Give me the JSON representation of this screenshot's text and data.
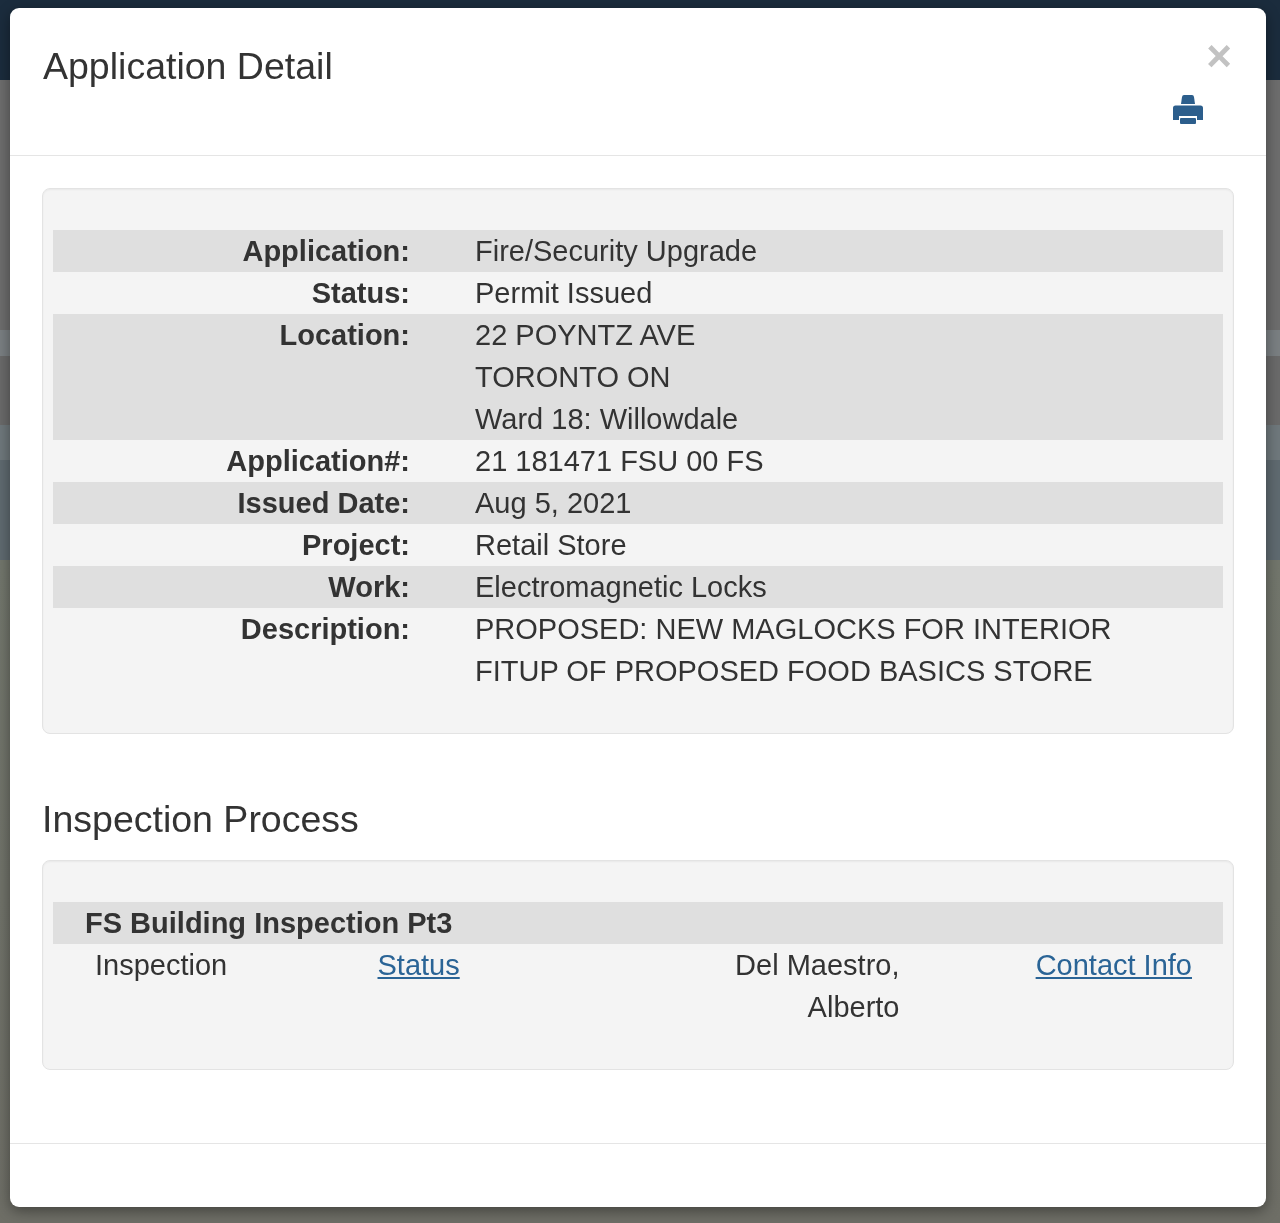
{
  "dialog": {
    "title": "Application Detail",
    "close": "×"
  },
  "details": {
    "rows": [
      {
        "label": "Application:",
        "lines": [
          "Fire/Security Upgrade"
        ]
      },
      {
        "label": "Status:",
        "lines": [
          "Permit Issued"
        ]
      },
      {
        "label": "Location:",
        "lines": [
          "22 POYNTZ AVE",
          "TORONTO ON",
          "Ward 18: Willowdale"
        ]
      },
      {
        "label": "Application#:",
        "lines": [
          "21 181471 FSU 00 FS"
        ]
      },
      {
        "label": "Issued Date:",
        "lines": [
          "Aug 5, 2021"
        ]
      },
      {
        "label": "Project:",
        "lines": [
          "Retail Store"
        ]
      },
      {
        "label": "Work:",
        "lines": [
          "Electromagnetic Locks"
        ]
      },
      {
        "label": "Description:",
        "lines": [
          "PROPOSED: NEW MAGLOCKS FOR INTERIOR FITUP OF PROPOSED FOOD BASICS STORE"
        ]
      }
    ]
  },
  "inspection": {
    "heading": "Inspection Process",
    "groups": [
      {
        "title": "FS Building Inspection Pt3",
        "rows": [
          {
            "type": "Inspection",
            "status": "Status",
            "inspector": "Del Maestro, Alberto",
            "contact": "Contact Info"
          }
        ]
      }
    ]
  }
}
